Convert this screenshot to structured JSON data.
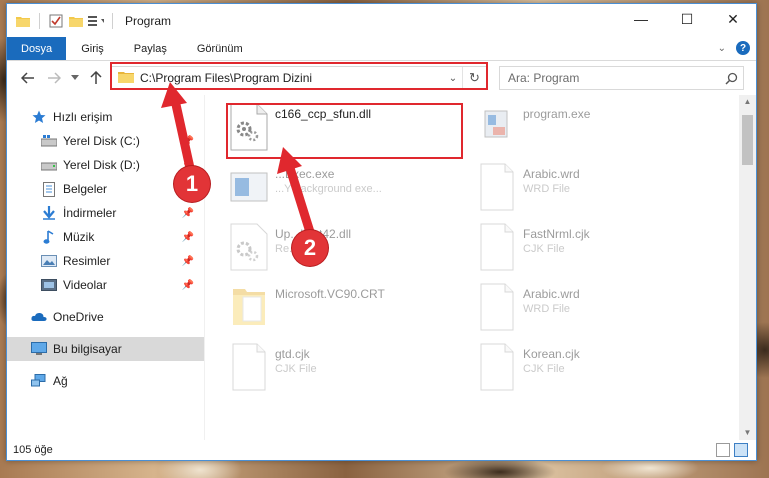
{
  "window": {
    "title": "Program",
    "minimize": "—",
    "maximize": "☐",
    "close": "✕"
  },
  "ribbon": {
    "tabs": [
      "Dosya",
      "Giriş",
      "Paylaş",
      "Görünüm"
    ],
    "help": "?"
  },
  "nav": {
    "address": "C:\\Program Files\\Program Dizini",
    "search_placeholder": "Ara: Program"
  },
  "sidebar": {
    "items": [
      {
        "label": "Hızlı erişim",
        "icon": "star-icon"
      },
      {
        "label": "Yerel Disk (C:)",
        "icon": "drive-icon"
      },
      {
        "label": "Yerel Disk (D:)",
        "icon": "drive-icon"
      },
      {
        "label": "Belgeler",
        "icon": "documents-icon"
      },
      {
        "label": "İndirmeler",
        "icon": "download-icon"
      },
      {
        "label": "Müzik",
        "icon": "music-icon"
      },
      {
        "label": "Resimler",
        "icon": "pictures-icon"
      },
      {
        "label": "Videolar",
        "icon": "videos-icon"
      },
      {
        "label": "OneDrive",
        "icon": "cloud-icon"
      },
      {
        "label": "Bu bilgisayar",
        "icon": "computer-icon"
      },
      {
        "label": "Ağ",
        "icon": "network-icon"
      }
    ]
  },
  "files": [
    {
      "name": "c166_ccp_sfun.dll",
      "type": "",
      "icon": "dll-gear-icon"
    },
    {
      "name": "program.exe",
      "type": "",
      "icon": "exe-icon"
    },
    {
      "name": "...Exec.exe",
      "type": "...Y background exe...",
      "icon": "exe-window-icon"
    },
    {
      "name": "Arabic.wrd",
      "type": "WRD File",
      "icon": "blank-file-icon"
    },
    {
      "name": "Up...lient42.dll",
      "type": "Re... DLL",
      "icon": "dll-gear-icon"
    },
    {
      "name": "FastNrml.cjk",
      "type": "CJK File",
      "icon": "blank-file-icon"
    },
    {
      "name": "Microsoft.VC90.CRT",
      "type": "",
      "icon": "folder-icon"
    },
    {
      "name": "Arabic.wrd",
      "type": "WRD File",
      "icon": "blank-file-icon"
    },
    {
      "name": "gtd.cjk",
      "type": "CJK File",
      "icon": "blank-file-icon"
    },
    {
      "name": "Korean.cjk",
      "type": "CJK File",
      "icon": "blank-file-icon"
    }
  ],
  "status": {
    "count": "105 öğe"
  },
  "annotations": {
    "step1": "1",
    "step2": "2",
    "color": "#e0282e"
  }
}
